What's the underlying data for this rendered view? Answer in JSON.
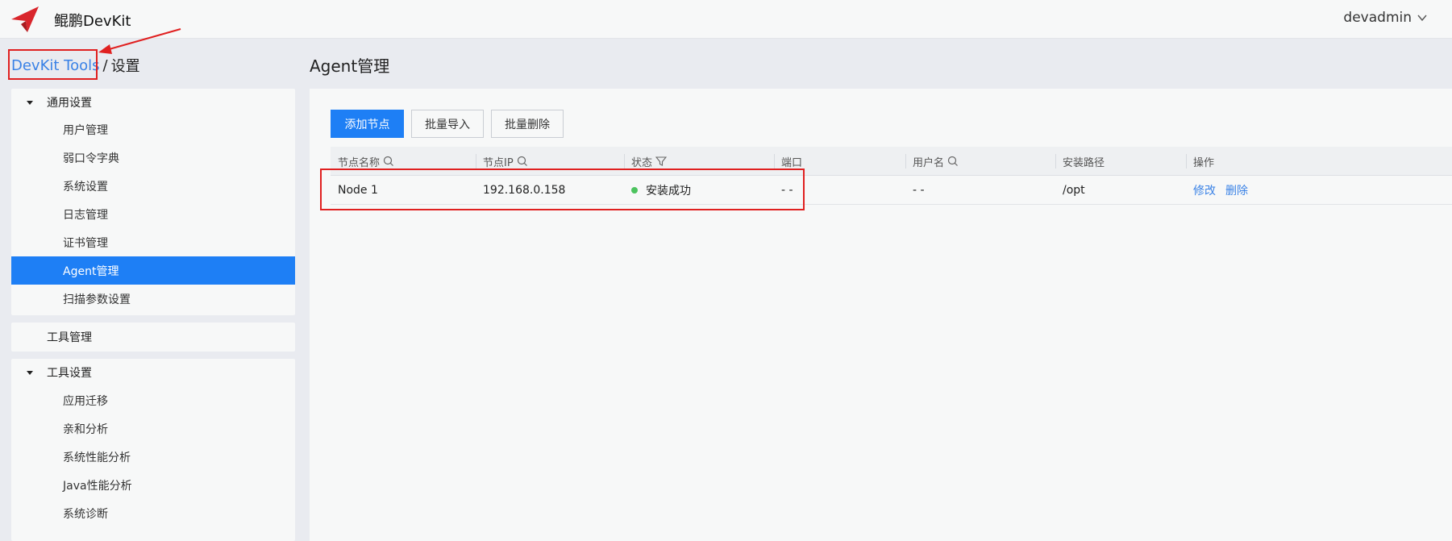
{
  "header": {
    "app_title": "鲲鹏DevKit",
    "user": "devadmin",
    "logo_icon": "kunpeng-logo-icon",
    "user_caret_icon": "chevron-down-icon"
  },
  "breadcrumb": {
    "link": "DevKit Tools",
    "separator": "/",
    "current": "设置"
  },
  "page_title": "Agent管理",
  "sidebar": {
    "groups": [
      {
        "label": "通用设置",
        "expanded": true,
        "items": [
          "用户管理",
          "弱口令字典",
          "系统设置",
          "日志管理",
          "证书管理",
          "Agent管理",
          "扫描参数设置"
        ]
      },
      {
        "label": "工具管理",
        "expanded": false,
        "items": []
      },
      {
        "label": "工具设置",
        "expanded": true,
        "items": [
          "应用迁移",
          "亲和分析",
          "系统性能分析",
          "Java性能分析",
          "系统诊断"
        ]
      }
    ],
    "active_item": "Agent管理"
  },
  "toolbar": {
    "add_label": "添加节点",
    "import_label": "批量导入",
    "delete_label": "批量删除"
  },
  "table": {
    "columns": [
      "节点名称",
      "节点IP",
      "状态",
      "端口",
      "用户名",
      "安装路径",
      "操作"
    ],
    "rows": [
      {
        "name": "Node 1",
        "ip": "192.168.0.158",
        "status": "安装成功",
        "port": "- -",
        "username": "- -",
        "path": "/opt",
        "actions": [
          "修改",
          "删除"
        ]
      }
    ]
  },
  "colors": {
    "accent": "#1e7ff5",
    "link": "#3a82e6",
    "success": "#4cc35e",
    "annotation": "#e02020"
  }
}
